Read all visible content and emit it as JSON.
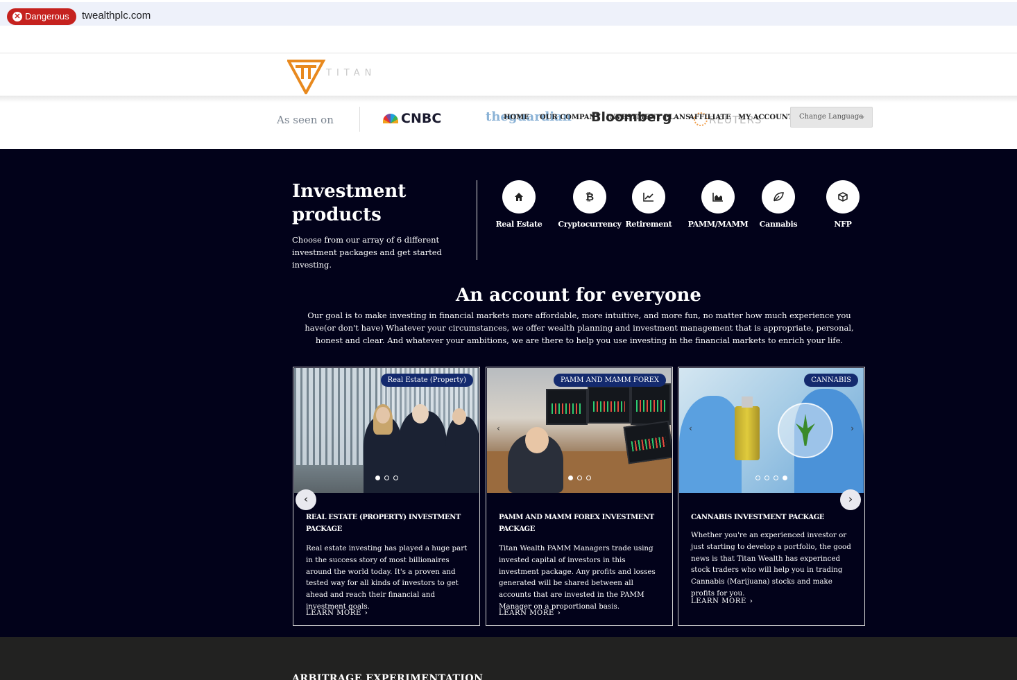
{
  "browser": {
    "danger_label": "Dangerous",
    "url": "twealthplc.com"
  },
  "logo": {
    "text": "TITAN",
    "colors": {
      "primary": "#e8891e",
      "accent": "#c9c9c9"
    }
  },
  "seen_on": {
    "label": "As seen on",
    "brands": [
      "CNBC",
      "theguardian",
      "Bloomberg",
      "REUTERS"
    ]
  },
  "nav": {
    "items": [
      "HOME",
      "OUR COMPANY",
      "INVESTMENT PLANS",
      "AFFILIATE",
      "MY ACCOUNT"
    ],
    "language_select": "Change Language"
  },
  "products": {
    "title": "Investment products",
    "description": "Choose from our array of 6 different investment packages and get started investing.",
    "items": [
      {
        "label": "Real Estate",
        "icon": "home-icon"
      },
      {
        "label": "Cryptocurrency",
        "icon": "bitcoin-icon"
      },
      {
        "label": "Retirement",
        "icon": "chart-line-icon"
      },
      {
        "label": "PAMM/MAMM",
        "icon": "area-chart-icon"
      },
      {
        "label": "Cannabis",
        "icon": "leaf-icon"
      },
      {
        "label": "NFP",
        "icon": "cube-icon"
      }
    ]
  },
  "account": {
    "title": "An account for everyone",
    "description": "Our goal is to make investing in financial markets more affordable, more intuitive, and more fun, no matter how much experience you have(or don't have) Whatever your circumstances, we offer wealth planning and investment management that is appropriate, personal, honest and clear. And whatever your ambitions, we are there to help you use investing in the financial markets to enrich your life."
  },
  "cards": [
    {
      "tag": "Real Estate (Property)",
      "title": "REAL ESTATE (PROPERTY) INVESTMENT PACKAGE",
      "body": "Real estate investing has played a huge part in the success story of most billionaires around the world today. It's a proven and tested way for all kinds of investors to get ahead and reach their financial and investment goals.",
      "link": "LEARN MORE"
    },
    {
      "tag": "PAMM AND MAMM FOREX",
      "title": "PAMM AND MAMM FOREX INVESTMENT PACKAGE",
      "body": "Titan Wealth PAMM Managers trade using invested capital of investors in this investment package. Any profits and losses generated will be shared between all accounts that are invested in the PAMM Manager on a proportional basis.",
      "link": "LEARN MORE"
    },
    {
      "tag": "CANNABIS",
      "title": "CANNABIS INVESTMENT PACKAGE",
      "body": "Whether you're an experienced investor or just starting to develop a portfolio, the good news is that Titan Wealth has experinced stock traders who will help you in trading Cannabis (Marijuana) stocks and make profits for you.",
      "link": "LEARN MORE"
    }
  ],
  "footer": {
    "title": "ARBITRAGE EXPERIMENTATION"
  },
  "colors": {
    "dark_bg": "#02021a",
    "danger": "#c5221f",
    "tag_bg": "#142a6e",
    "footer_bg": "#222221"
  }
}
